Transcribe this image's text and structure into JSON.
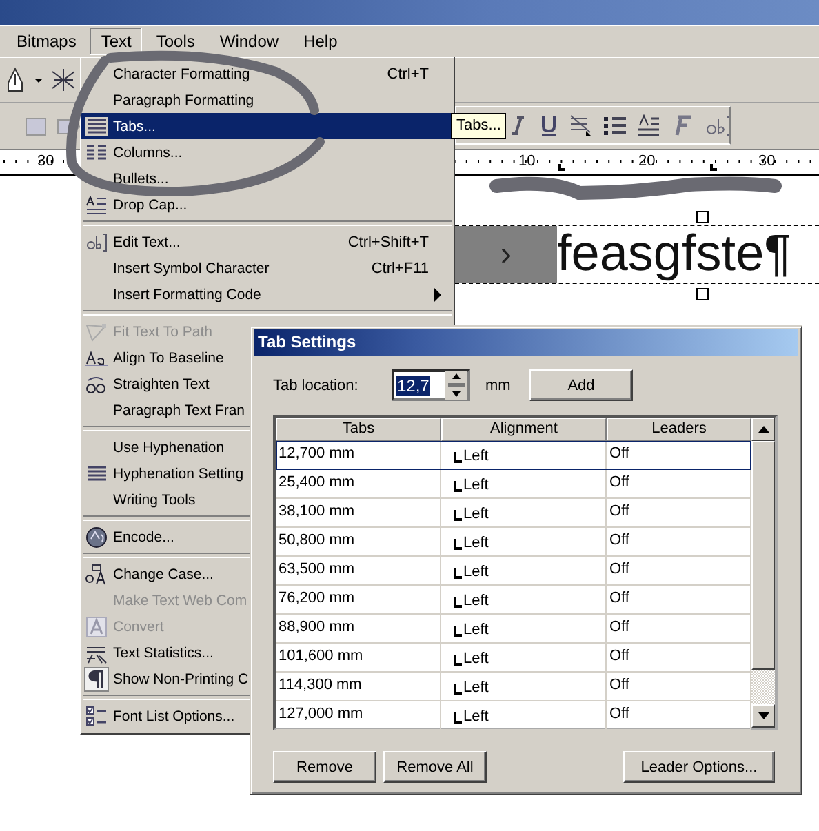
{
  "menubar": [
    {
      "label": "Bitmaps",
      "selected": false
    },
    {
      "label": "Text",
      "selected": true
    },
    {
      "label": "Tools",
      "selected": false
    },
    {
      "label": "Window",
      "selected": false
    },
    {
      "label": "Help",
      "selected": false
    }
  ],
  "ruler": {
    "left_labels": [
      "30"
    ],
    "right_labels": [
      "10",
      "20",
      "30"
    ]
  },
  "canvas": {
    "frame_text": "feasgfste¶",
    "tab_mark": "›"
  },
  "tooltip": "Tabs...",
  "menu": {
    "items": [
      {
        "kind": "item",
        "label": "Character Formatting",
        "shortcut": "Ctrl+T",
        "disabled": false,
        "selected": false
      },
      {
        "kind": "item",
        "label": "Paragraph Formatting",
        "disabled": false,
        "selected": false
      },
      {
        "kind": "item",
        "label": "Tabs...",
        "disabled": false,
        "selected": true
      },
      {
        "kind": "item",
        "label": "Columns...",
        "disabled": false,
        "selected": false
      },
      {
        "kind": "item",
        "label": "Bullets...",
        "disabled": false,
        "selected": false
      },
      {
        "kind": "item",
        "label": "Drop Cap...",
        "disabled": false,
        "selected": false
      },
      {
        "kind": "separator"
      },
      {
        "kind": "item",
        "label": "Edit Text...",
        "shortcut": "Ctrl+Shift+T",
        "disabled": false,
        "selected": false
      },
      {
        "kind": "item",
        "label": "Insert Symbol Character",
        "shortcut": "Ctrl+F11",
        "disabled": false,
        "selected": false
      },
      {
        "kind": "item",
        "label": "Insert Formatting Code",
        "submenu": true,
        "disabled": false,
        "selected": false
      },
      {
        "kind": "separator"
      },
      {
        "kind": "item",
        "label": "Fit Text To Path",
        "disabled": true,
        "selected": false
      },
      {
        "kind": "item",
        "label": "Align To Baseline",
        "disabled": false,
        "selected": false
      },
      {
        "kind": "item",
        "label": "Straighten Text",
        "disabled": false,
        "selected": false
      },
      {
        "kind": "item",
        "label": "Paragraph Text Fran",
        "disabled": false,
        "selected": false
      },
      {
        "kind": "separator"
      },
      {
        "kind": "item",
        "label": "Use Hyphenation",
        "disabled": false,
        "selected": false
      },
      {
        "kind": "item",
        "label": "Hyphenation Setting",
        "disabled": false,
        "selected": false
      },
      {
        "kind": "item",
        "label": "Writing Tools",
        "disabled": false,
        "selected": false
      },
      {
        "kind": "separator"
      },
      {
        "kind": "item",
        "label": "Encode...",
        "disabled": false,
        "selected": false
      },
      {
        "kind": "separator"
      },
      {
        "kind": "item",
        "label": "Change Case...",
        "disabled": false,
        "selected": false
      },
      {
        "kind": "item",
        "label": "Make Text Web Com",
        "disabled": true,
        "selected": false
      },
      {
        "kind": "item",
        "label": "Convert",
        "disabled": true,
        "selected": false
      },
      {
        "kind": "item",
        "label": "Text Statistics...",
        "disabled": false,
        "selected": false
      },
      {
        "kind": "item",
        "label": "Show Non-Printing C",
        "disabled": false,
        "selected": false
      },
      {
        "kind": "separator"
      },
      {
        "kind": "item",
        "label": "Font List Options...",
        "disabled": false,
        "selected": false
      }
    ]
  },
  "dialog": {
    "title": "Tab Settings",
    "tab_location_label": "Tab location:",
    "tab_location_value": "12,7",
    "unit": "mm",
    "add_button": "Add",
    "table": {
      "columns": [
        "Tabs",
        "Alignment",
        "Leaders"
      ],
      "rows": [
        {
          "tab": "12,700 mm",
          "alignment": "Left",
          "leaders": "Off",
          "selected": true
        },
        {
          "tab": "25,400 mm",
          "alignment": "Left",
          "leaders": "Off",
          "selected": false
        },
        {
          "tab": "38,100 mm",
          "alignment": "Left",
          "leaders": "Off",
          "selected": false
        },
        {
          "tab": "50,800 mm",
          "alignment": "Left",
          "leaders": "Off",
          "selected": false
        },
        {
          "tab": "63,500 mm",
          "alignment": "Left",
          "leaders": "Off",
          "selected": false
        },
        {
          "tab": "76,200 mm",
          "alignment": "Left",
          "leaders": "Off",
          "selected": false
        },
        {
          "tab": "88,900 mm",
          "alignment": "Left",
          "leaders": "Off",
          "selected": false
        },
        {
          "tab": "101,600 mm",
          "alignment": "Left",
          "leaders": "Off",
          "selected": false
        },
        {
          "tab": "114,300 mm",
          "alignment": "Left",
          "leaders": "Off",
          "selected": false
        },
        {
          "tab": "127,000 mm",
          "alignment": "Left",
          "leaders": "Off",
          "selected": false
        }
      ]
    },
    "buttons": [
      "Remove",
      "Remove All",
      "Leader Options..."
    ]
  }
}
